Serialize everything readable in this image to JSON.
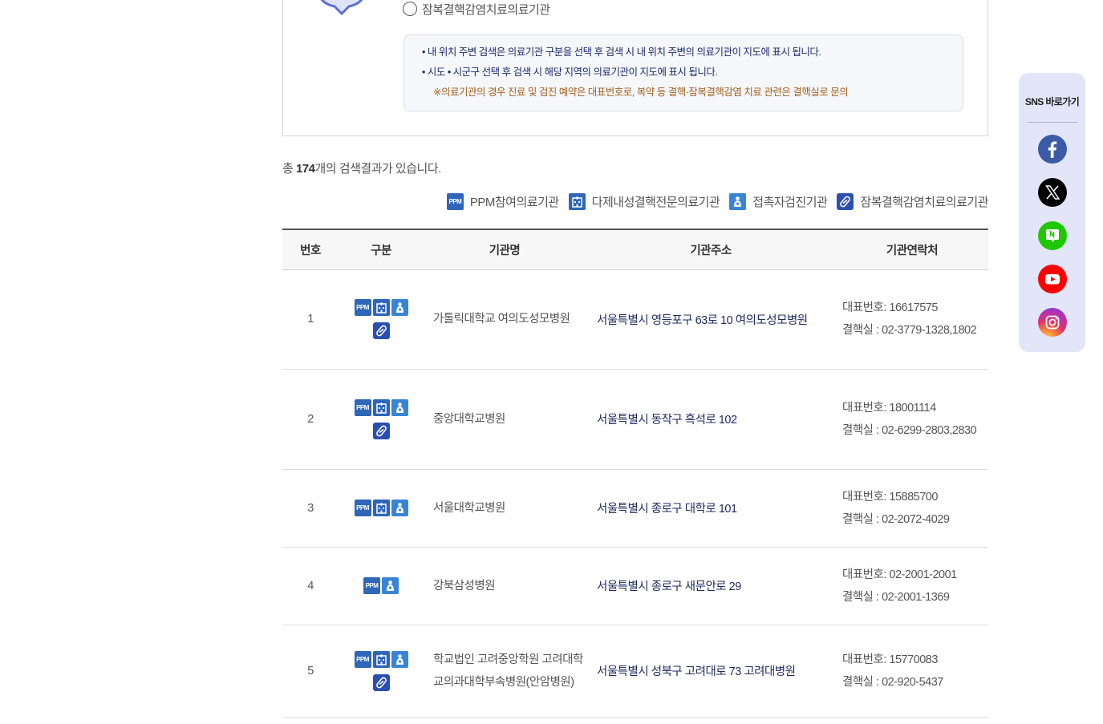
{
  "search": {
    "radio_label": "잠복결핵감염치료의료기관",
    "notices": [
      "• 내 위치 주변 검색은 의료기관 구분을 선택 후 검색 시 내 위치 주변의 의료기관이 지도에 표시 됩니다.",
      "• 시도 • 시군구 선택 후 검색 시 해당 지역의 의료기관이 지도에 표시 됩니다."
    ],
    "warning": "※의료기관의 경우 진료 및 검진 예약은 대표번호로, 복약 등 결핵·잠복결핵감염 치료 관련은 결핵실로 문의"
  },
  "results": {
    "prefix": "총 ",
    "count": "174",
    "suffix": "개의 검색결과가 있습니다."
  },
  "legend": [
    {
      "icon": "ppm",
      "label": "PPM참여의료기관"
    },
    {
      "icon": "hospital",
      "label": "다제내성결핵전문의료기관"
    },
    {
      "icon": "person",
      "label": "접촉자검진기관"
    },
    {
      "icon": "pill",
      "label": "잠복결핵감염치료의료기관"
    }
  ],
  "table": {
    "headers": [
      "번호",
      "구분",
      "기관명",
      "기관주소",
      "기관연락처"
    ],
    "rows": [
      {
        "no": "1",
        "name": "가톨릭대학교 여의도성모병원",
        "address": "서울특별시 영등포구 63로 10 여의도성모병원",
        "main_phone": "대표번호: 16617575",
        "tb_phone": "결핵실 : 02-3779-1328,1802"
      },
      {
        "no": "2",
        "name": "중앙대학교병원",
        "address": "서울특별시 동작구 흑석로 102",
        "main_phone": "대표번호: 18001114",
        "tb_phone": "결핵실 : 02-6299-2803,2830"
      },
      {
        "no": "3",
        "name": "서울대학교병원",
        "address": "서울특별시 종로구 대학로 101",
        "main_phone": "대표번호: 15885700",
        "tb_phone": "결핵실 : 02-2072-4029"
      },
      {
        "no": "4",
        "name": "강북삼성병원",
        "address": "서울특별시 종로구 새문안로 29",
        "main_phone": "대표번호: 02-2001-2001",
        "tb_phone": "결핵실 : 02-2001-1369"
      },
      {
        "no": "5",
        "name": "학교법인 고려중앙학원 고려대학교의과대학부속병원(안암병원)",
        "address": "서울특별시 성북구 고려대로 73 고려대병원",
        "main_phone": "대표번호: 15770083",
        "tb_phone": "결핵실 : 02-920-5437"
      }
    ]
  },
  "sns": {
    "title": "SNS 바로가기",
    "items": [
      "facebook-icon",
      "x-icon",
      "blog-icon",
      "youtube-icon",
      "instagram-icon"
    ]
  },
  "icons": {
    "ppm_text": "PPM"
  },
  "colors": {
    "icon_blue": "#2f66b8",
    "address_text": "#1f2a5f",
    "warning_text": "#a0611f",
    "sns_panel": "#e3e5f9"
  }
}
